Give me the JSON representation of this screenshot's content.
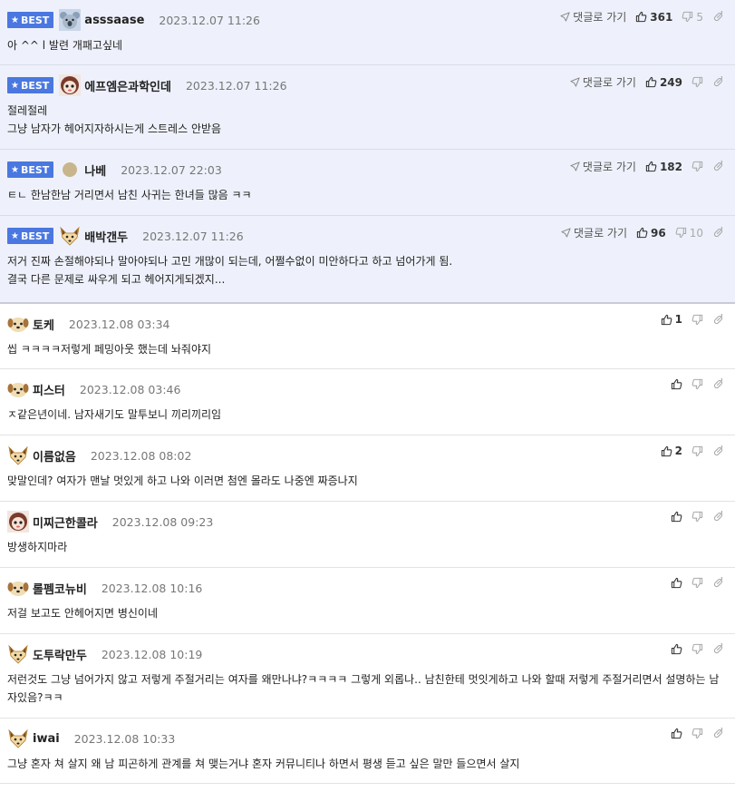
{
  "ui": {
    "best_label": "BEST",
    "reply_to_label": "댓글로 가기"
  },
  "colors": {
    "best_bg": "#eef1fb",
    "badge": "#4a78e0"
  },
  "comments": [
    {
      "best": true,
      "avatar": "koala-avatar",
      "nick": "asssaase",
      "date": "2023.12.07 11:26",
      "lines": [
        "아 ^^ l 발련 개패고싶네"
      ],
      "up": "361",
      "down": "5",
      "show_reply": true
    },
    {
      "best": true,
      "avatar": "doll-avatar",
      "nick": "에프엠은과학인데",
      "date": "2023.12.07 11:26",
      "lines": [
        "절레절레",
        "그냥 남자가 헤어지자하시는게 스트레스 안받음"
      ],
      "up": "249",
      "down": "",
      "show_reply": true
    },
    {
      "best": true,
      "avatar": "circle-avatar",
      "nick": "나베",
      "date": "2023.12.07 22:03",
      "lines": [
        "ㅌㄴ 한남한남 거리면서 남친 사귀는 한녀들 많음 ㅋㅋ"
      ],
      "up": "182",
      "down": "",
      "show_reply": true
    },
    {
      "best": true,
      "avatar": "fox-avatar",
      "nick": "배박갠두",
      "date": "2023.12.07 11:26",
      "lines": [
        "저거 진짜 손절해야되나 말아야되나 고민 개많이 되는데, 어쩔수없이 미안하다고 하고 넘어가게 됨.",
        "결국 다른 문제로 싸우게 되고 헤어지게되겠지..."
      ],
      "up": "96",
      "down": "10",
      "show_reply": true
    },
    {
      "best": false,
      "avatar": "puppy-avatar",
      "nick": "토케",
      "date": "2023.12.08 03:34",
      "lines": [
        "씹 ㅋㅋㅋㅋ저렇게 페밍아웃 했는데 놔줘야지"
      ],
      "up": "1",
      "down": "",
      "show_reply": false
    },
    {
      "best": false,
      "avatar": "puppy-avatar",
      "nick": "피스터",
      "date": "2023.12.08 03:46",
      "lines": [
        "ㅈ같은년이네. 남자새기도 말투보니 끼리끼리임"
      ],
      "up": "",
      "down": "",
      "show_reply": false
    },
    {
      "best": false,
      "avatar": "fox-avatar",
      "nick": "이름없음",
      "date": "2023.12.08 08:02",
      "lines": [
        "맞말인데? 여자가 맨날 멋있게 하고 나와 이러면 첨엔 몰라도 나중엔 짜증나지"
      ],
      "up": "2",
      "down": "",
      "show_reply": false
    },
    {
      "best": false,
      "avatar": "doll-avatar",
      "nick": "미찌근한콜라",
      "date": "2023.12.08 09:23",
      "lines": [
        "방생하지마라"
      ],
      "up": "",
      "down": "",
      "show_reply": false
    },
    {
      "best": false,
      "avatar": "puppy-avatar",
      "nick": "롤펨코뉴비",
      "date": "2023.12.08 10:16",
      "lines": [
        "저걸 보고도 안헤어지면 병신이네"
      ],
      "up": "",
      "down": "",
      "show_reply": false
    },
    {
      "best": false,
      "avatar": "fox-avatar",
      "nick": "도투락만두",
      "date": "2023.12.08 10:19",
      "lines": [
        "저런것도 그냥 넘어가지 않고 저렇게 주절거리는 여자를 왜만나냐?ㅋㅋㅋㅋ 그렇게 외롭나.. 남친한테 멋잇게하고 나와 할때 저렇게 주절거리면서 설명하는 남",
        "자있음?ㅋㅋ"
      ],
      "up": "",
      "down": "",
      "show_reply": false
    },
    {
      "best": false,
      "avatar": "fox-avatar",
      "nick": "iwai",
      "date": "2023.12.08 10:33",
      "lines": [
        "그냥 혼자 쳐 살지 왜 남 피곤하게 관계를 쳐 맺는거냐 혼자 커뮤니티나 하면서 평생 듣고 싶은 말만 들으면서 살지"
      ],
      "up": "",
      "down": "",
      "show_reply": false
    }
  ]
}
